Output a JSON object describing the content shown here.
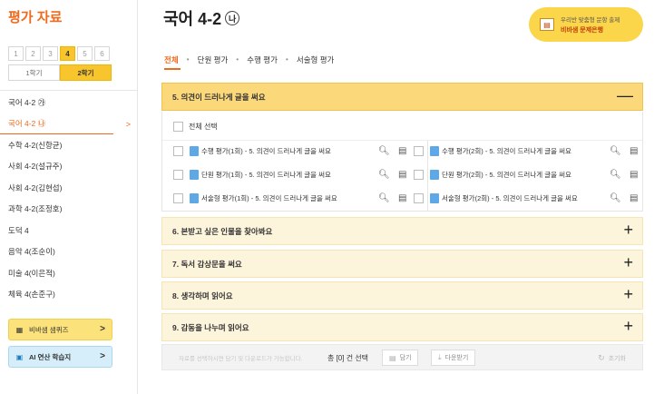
{
  "sidebar": {
    "title": "평가 자료",
    "grades": [
      "1",
      "2",
      "3",
      "4",
      "5",
      "6"
    ],
    "active_grade": "4",
    "terms": [
      "1학기",
      "2학기"
    ],
    "active_term": "2학기",
    "subjects": [
      {
        "label": "국어 4-2 ㉮",
        "active": false
      },
      {
        "label": "국어 4-2 ㉯",
        "active": true
      },
      {
        "label": "수학 4-2(신항균)",
        "active": false
      },
      {
        "label": "사회 4-2(설규주)",
        "active": false
      },
      {
        "label": "사회 4-2(김현섭)",
        "active": false
      },
      {
        "label": "과학 4-2(조정호)",
        "active": false
      },
      {
        "label": "도덕 4",
        "active": false
      },
      {
        "label": "음악 4(조순이)",
        "active": false
      },
      {
        "label": "미술 4(이은적)",
        "active": false
      },
      {
        "label": "체육 4(손준구)",
        "active": false
      }
    ],
    "active_chevron": ">",
    "quiz_button": "비바샘 샘퀴즈",
    "ai_button": "AI 연산 학습지",
    "arrow": ">"
  },
  "header": {
    "title": "국어 4-2",
    "badge": "나"
  },
  "promo": {
    "line1": "우리반 맞춤형 문항 출제",
    "line2": "비바샘 문제은행"
  },
  "tabs": [
    "전체",
    "단원 평가",
    "수행 평가",
    "서술형 평가"
  ],
  "tab_separator": "•",
  "active_tab": "전체",
  "sections": [
    {
      "label": "5. 의견이 드러나게 글을 써요",
      "open": true,
      "toggle": "—"
    },
    {
      "label": "6. 본받고 싶은 인물을 찾아봐요",
      "open": false,
      "toggle": "+"
    },
    {
      "label": "7. 독서 감상문을 써요",
      "open": false,
      "toggle": "+"
    },
    {
      "label": "8. 생각하며 읽어요",
      "open": false,
      "toggle": "+"
    },
    {
      "label": "9. 감동을 나누며 읽어요",
      "open": false,
      "toggle": "+"
    }
  ],
  "open_section": {
    "select_all": "전체 선택",
    "items_left": [
      "수행 평가(1회) - 5. 의견이 드러나게 글을 써요",
      "단원 평가(1회) - 5. 의견이 드러나게 글을 써요",
      "서술형 평가(1회) - 5. 의견이 드러나게 글을 써요"
    ],
    "items_right": [
      "수행 평가(2회) - 5. 의견이 드러나게 글을 써요",
      "단원 평가(2회) - 5. 의견이 드러나게 글을 써요",
      "서술형 평가(2회) - 5. 의견이 드러나게 글을 써요"
    ],
    "preview_icon": "magnifier-icon",
    "file_icon": "document-box-icon"
  },
  "footer": {
    "hint": "자료를 선택하시면 담기 및 다운로드가 가능합니다.",
    "count": "총 [0] 건 선택",
    "save_button": "담기",
    "download_button": "다운받기",
    "reset": "초기화"
  }
}
